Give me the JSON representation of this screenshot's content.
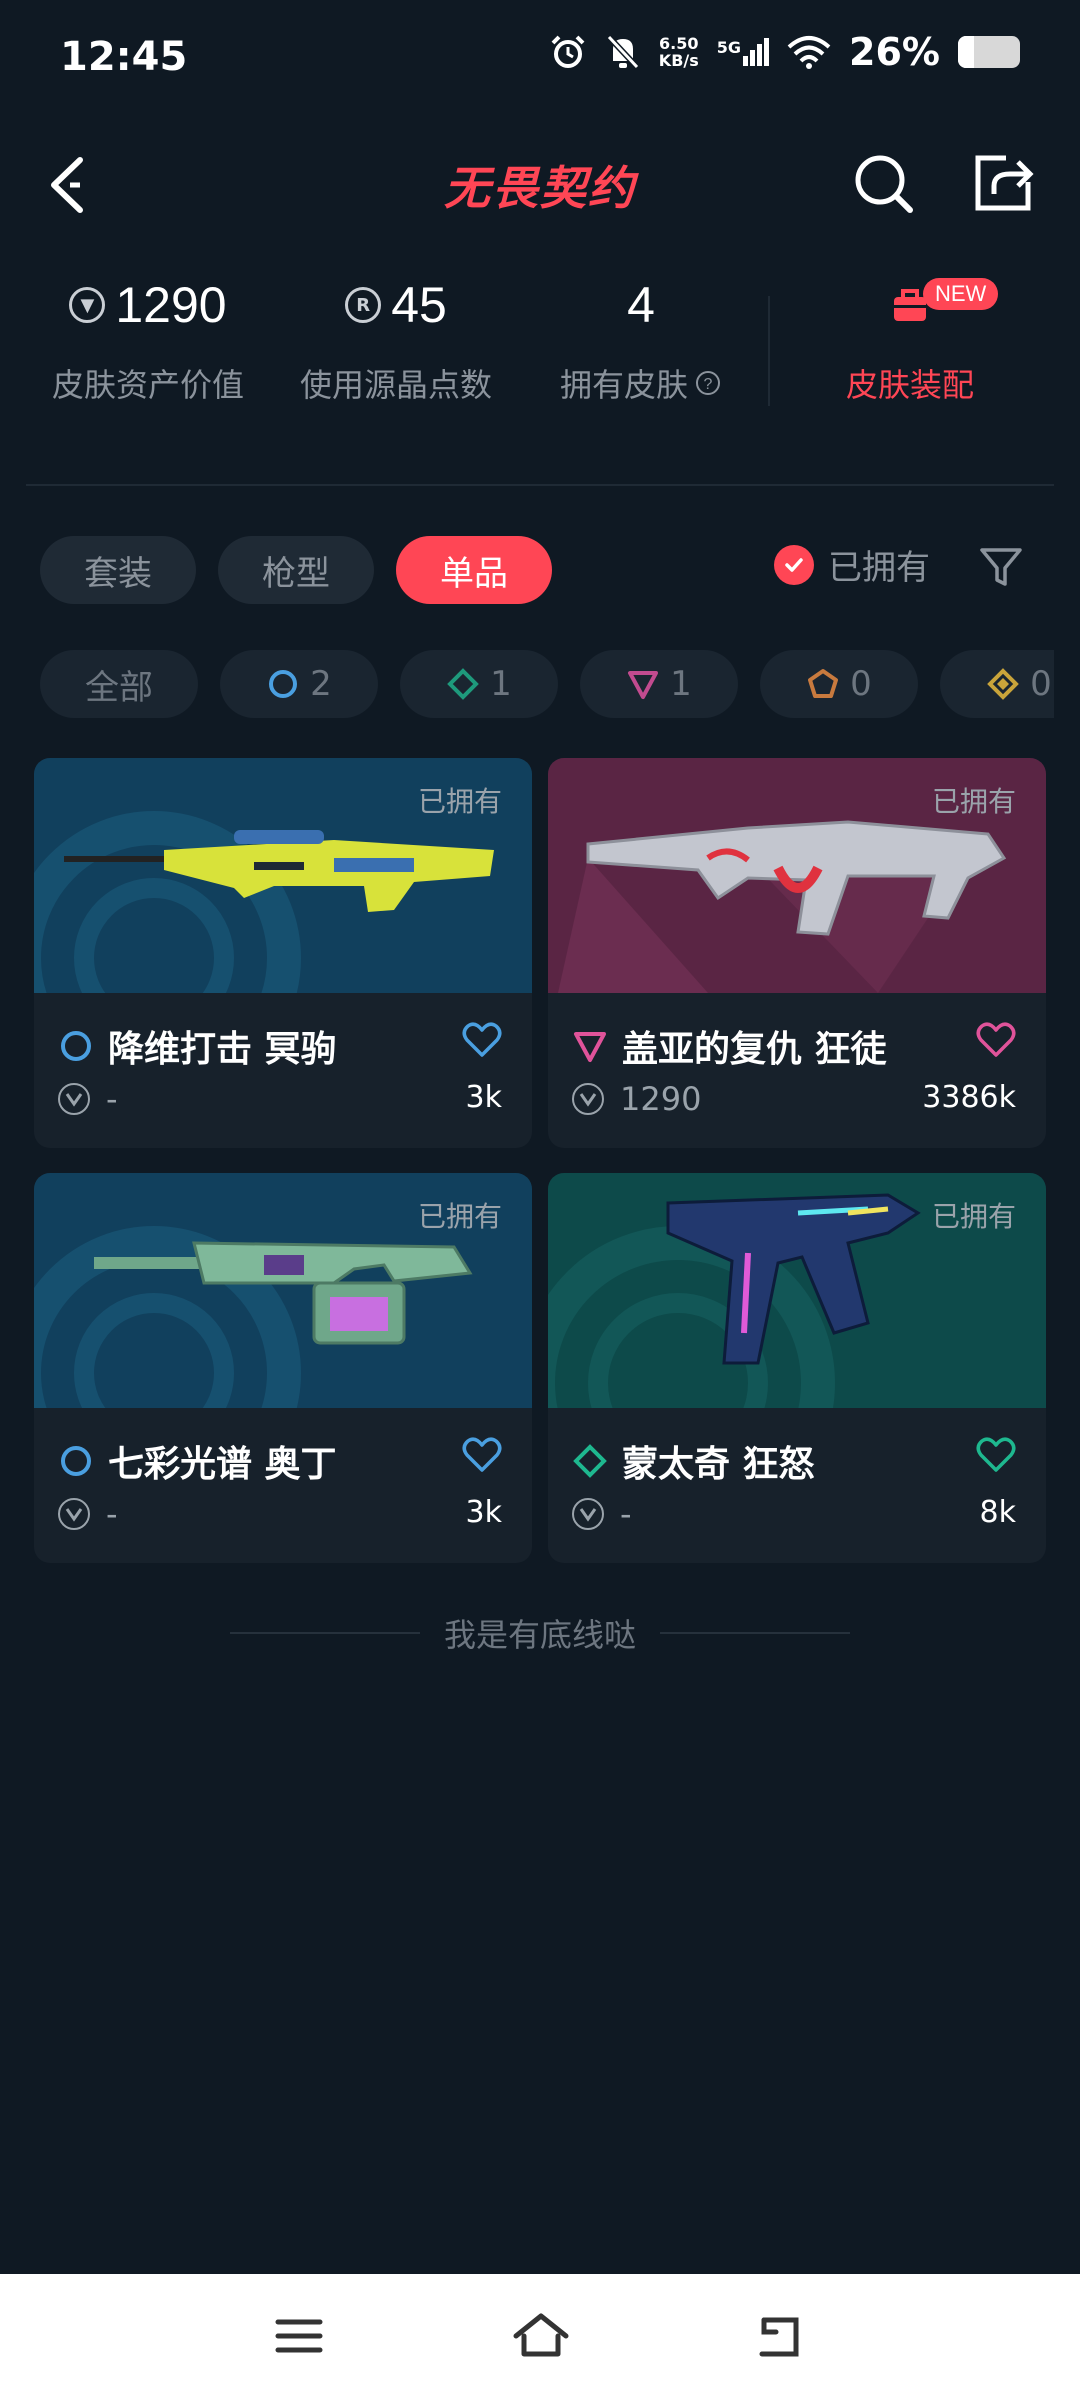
{
  "status_bar": {
    "time": "12:45",
    "net_speed": "6.50",
    "net_unit": "KB/s",
    "signal": "5G",
    "battery_pct": "26%",
    "battery_level": 0.26
  },
  "header": {
    "title": "无畏契约"
  },
  "stats": {
    "asset_value": "1290",
    "asset_value_label": "皮肤资产价值",
    "radianite": "45",
    "radianite_label": "使用源晶点数",
    "skins_owned": "4",
    "skins_owned_label": "拥有皮肤",
    "loadout_label": "皮肤装配",
    "new_badge": "NEW"
  },
  "tabs": [
    {
      "label": "套装",
      "active": false
    },
    {
      "label": "枪型",
      "active": false
    },
    {
      "label": "单品",
      "active": true
    }
  ],
  "owned_filter_label": "已拥有",
  "chips": [
    {
      "label": "全部",
      "icon": "none"
    },
    {
      "count": "2",
      "icon": "select-tier-icon",
      "color": "#4a9fe0"
    },
    {
      "count": "1",
      "icon": "deluxe-tier-icon",
      "color": "#1e9a7c"
    },
    {
      "count": "1",
      "icon": "premium-tier-icon",
      "color": "#c24b8f"
    },
    {
      "count": "0",
      "icon": "exclusive-tier-icon",
      "color": "#c87a3e"
    },
    {
      "count": "0",
      "icon": "ultra-tier-icon",
      "color": "#c9a43a"
    }
  ],
  "cards": [
    {
      "owned": "已拥有",
      "name": "降维打击 冥驹",
      "price": "-",
      "likes": "3k",
      "tier_color": "#4a9fe0",
      "bg": "#11405d",
      "tier_icon": "select-tier-icon"
    },
    {
      "owned": "已拥有",
      "name": "盖亚的复仇 狂徒",
      "price": "1290",
      "likes": "3386k",
      "tier_color": "#e0539a",
      "bg": "#5a2544",
      "tier_icon": "premium-tier-icon"
    },
    {
      "owned": "已拥有",
      "name": "七彩光谱 奥丁",
      "price": "-",
      "likes": "3k",
      "tier_color": "#4a9fe0",
      "bg": "#11405d",
      "tier_icon": "select-tier-icon"
    },
    {
      "owned": "已拥有",
      "name": "蒙太奇 狂怒",
      "price": "-",
      "likes": "8k",
      "tier_color": "#1eb88f",
      "bg": "#0d4a4a",
      "tier_icon": "deluxe-tier-icon"
    }
  ],
  "footer_text": "我是有底线哒"
}
